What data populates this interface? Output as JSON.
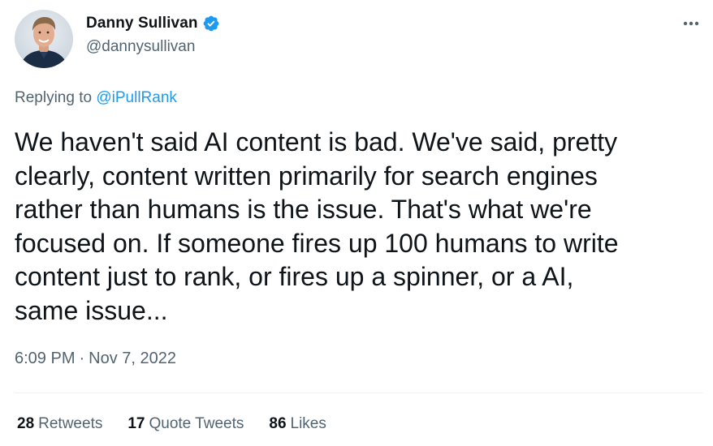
{
  "author": {
    "display_name": "Danny Sullivan",
    "handle": "@dannysullivan",
    "verified_icon": "verified-badge-icon",
    "avatar": "profile-photo"
  },
  "reply": {
    "prefix": "Replying to",
    "handle": "@iPullRank"
  },
  "tweet": {
    "lines": [
      "We haven't said AI content is bad. We've said, pretty",
      "clearly, content written primarily for search engines",
      "rather than humans is the issue. That's what we're",
      "focused on. If someone fires up 100 humans to write",
      "content just to rank, or fires up a spinner, or a AI,",
      "same issue..."
    ],
    "time": "6:09 PM",
    "separator": "·",
    "date": "Nov 7, 2022"
  },
  "stats": [
    {
      "count": "28",
      "label": "Retweets"
    },
    {
      "count": "17",
      "label": "Quote Tweets"
    },
    {
      "count": "86",
      "label": "Likes"
    }
  ],
  "more_icon": "more-horizontal-icon",
  "colors": {
    "text": "#0f1419",
    "secondary": "#536471",
    "accent": "#1d9bf0",
    "divider": "#eff3f4"
  }
}
